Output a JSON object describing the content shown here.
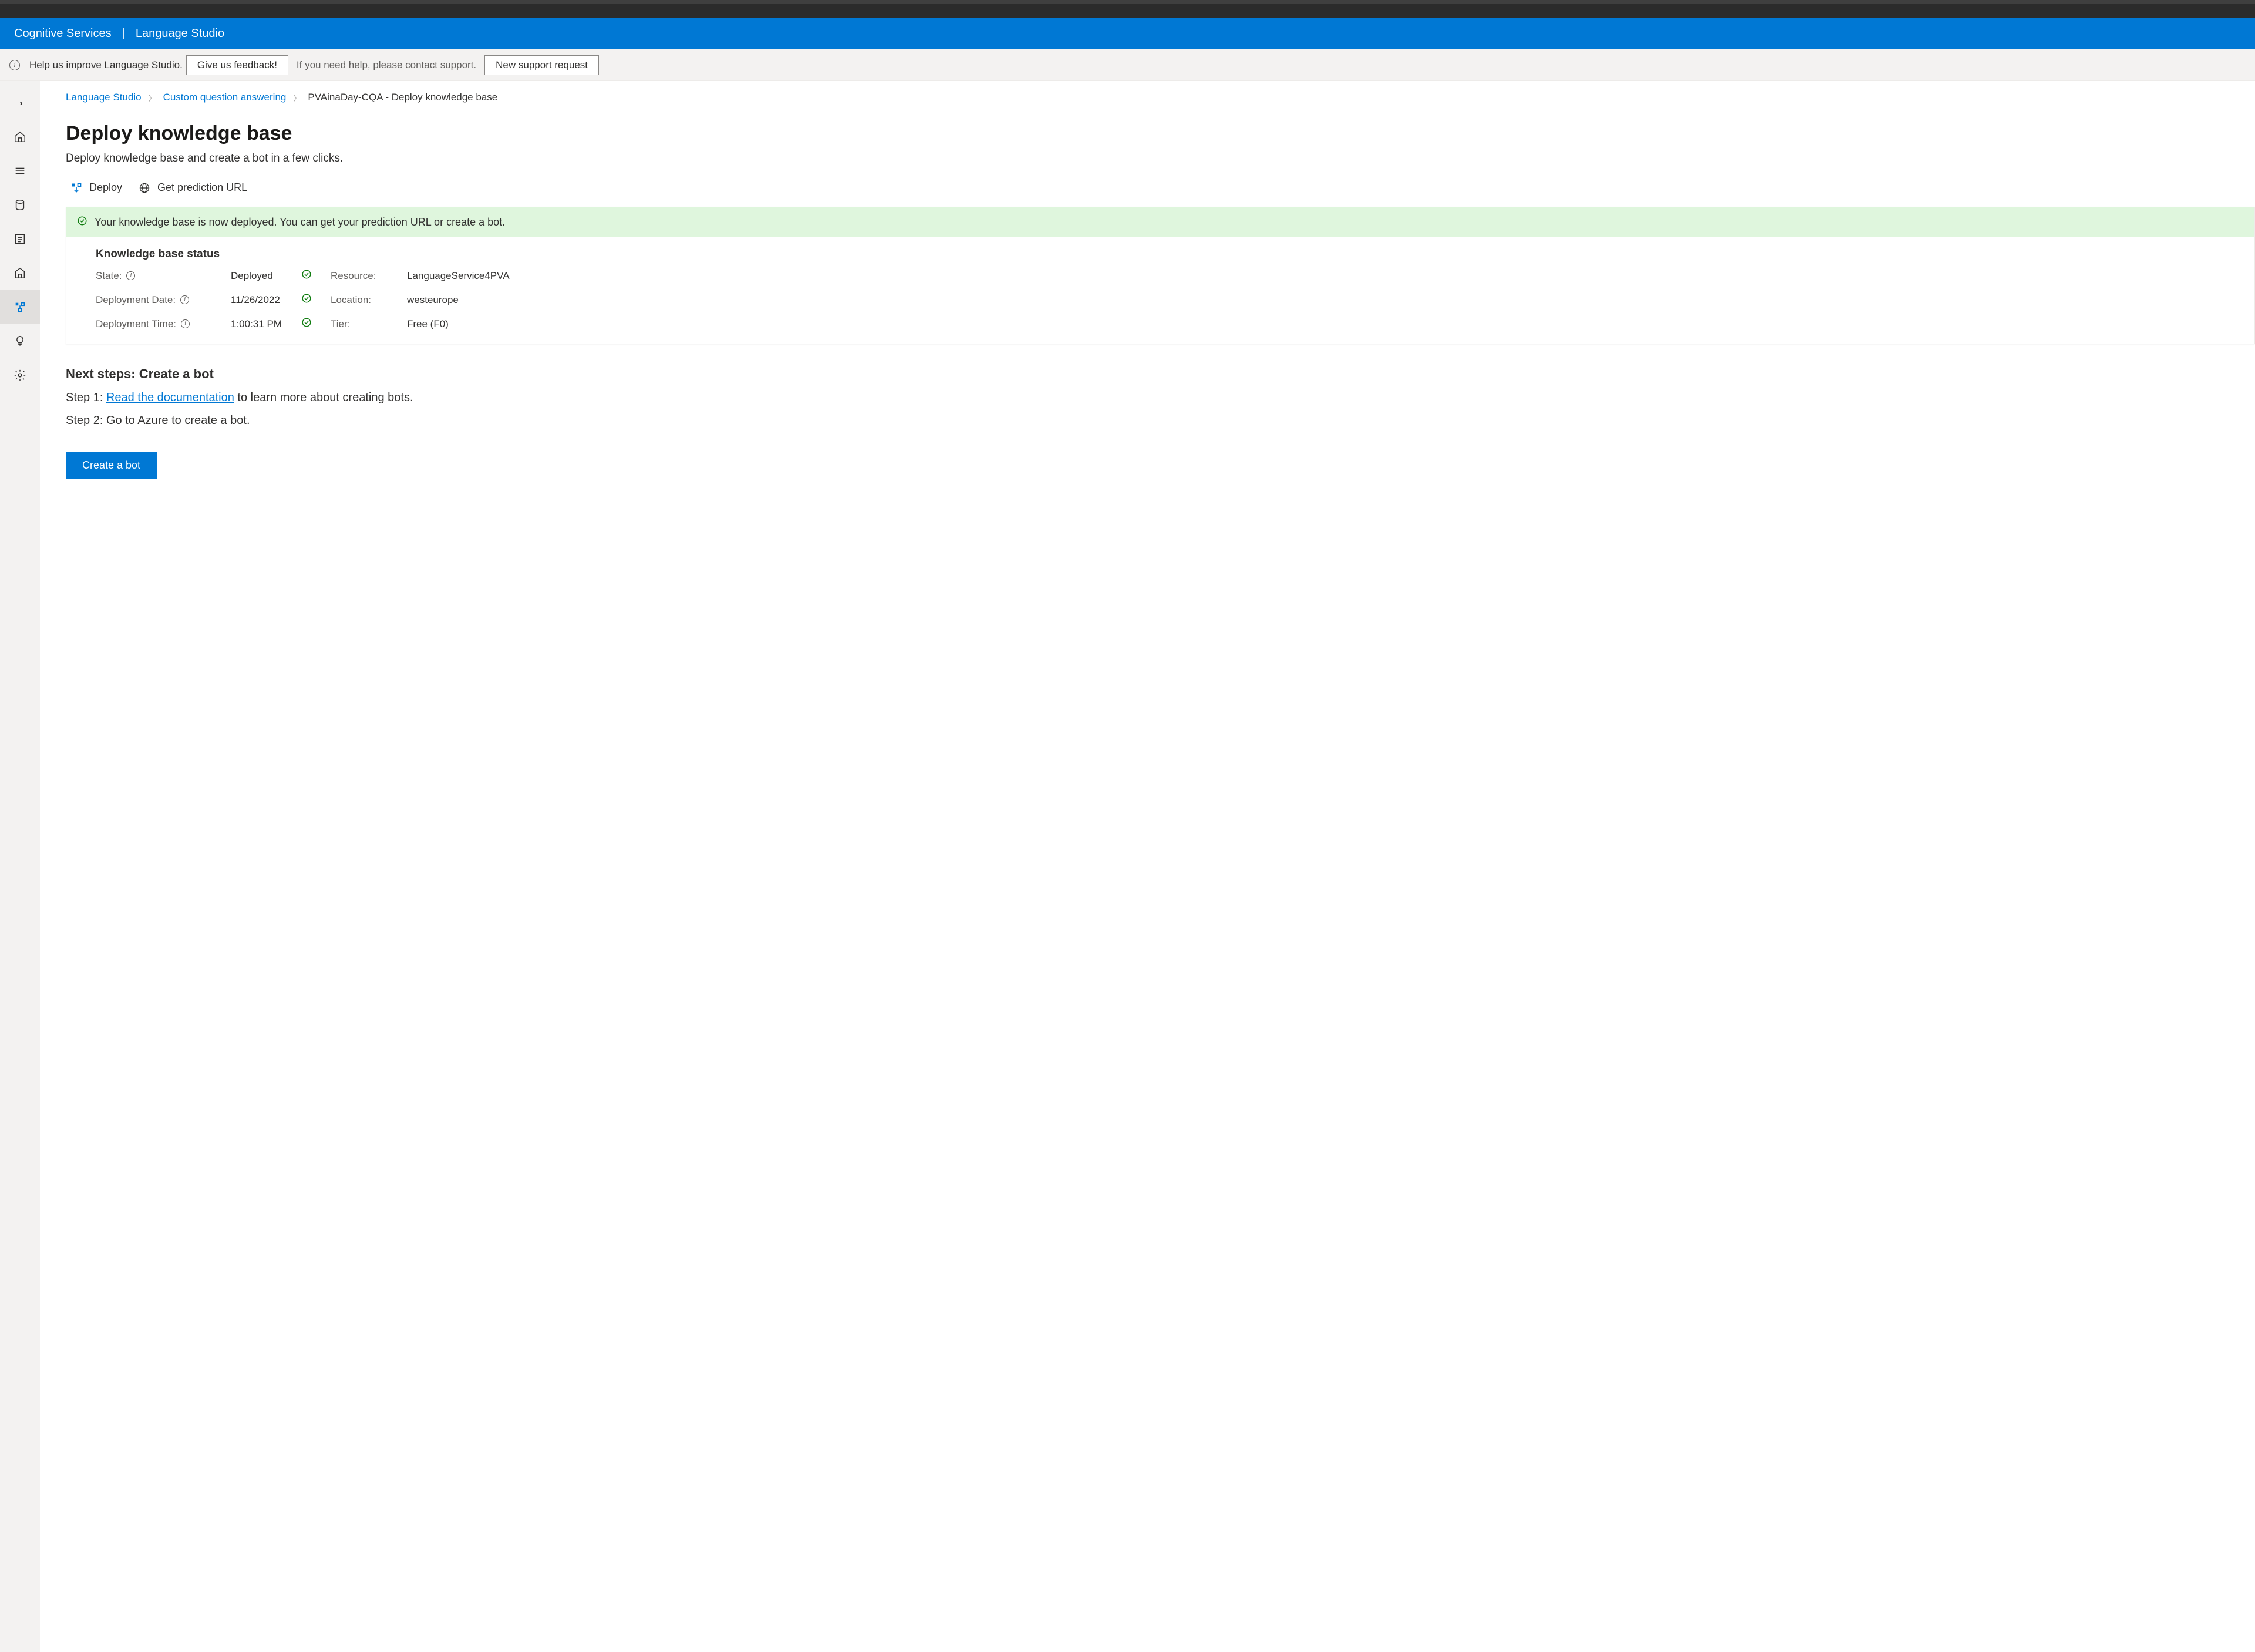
{
  "header": {
    "left": "Cognitive Services",
    "right": "Language Studio"
  },
  "helpBar": {
    "improve": "Help us improve Language Studio.",
    "feedback_btn": "Give us feedback!",
    "contact": "If you need help, please contact support.",
    "support_btn": "New support request"
  },
  "breadcrumb": {
    "l1": "Language Studio",
    "l2": "Custom question answering",
    "l3": "PVAinaDay-CQA - Deploy knowledge base"
  },
  "page": {
    "title": "Deploy knowledge base",
    "subtitle": "Deploy knowledge base and create a bot in a few clicks."
  },
  "toolbar": {
    "deploy": "Deploy",
    "predict": "Get prediction URL"
  },
  "banner": {
    "text": "Your knowledge base is now deployed. You can get your prediction URL or create a bot."
  },
  "status": {
    "title": "Knowledge base status",
    "rows": {
      "state_lbl": "State:",
      "state_val": "Deployed",
      "resource_lbl": "Resource:",
      "resource_val": "LanguageService4PVA",
      "date_lbl": "Deployment Date:",
      "date_val": "11/26/2022",
      "location_lbl": "Location:",
      "location_val": "westeurope",
      "time_lbl": "Deployment Time:",
      "time_val": "1:00:31 PM",
      "tier_lbl": "Tier:",
      "tier_val": "Free (F0)"
    }
  },
  "next": {
    "heading": "Next steps: Create a bot",
    "step1_prefix": "Step 1: ",
    "step1_link": "Read the documentation",
    "step1_suffix": " to learn more about creating bots.",
    "step2": "Step 2: Go to Azure to create a bot.",
    "cta": "Create a bot"
  }
}
